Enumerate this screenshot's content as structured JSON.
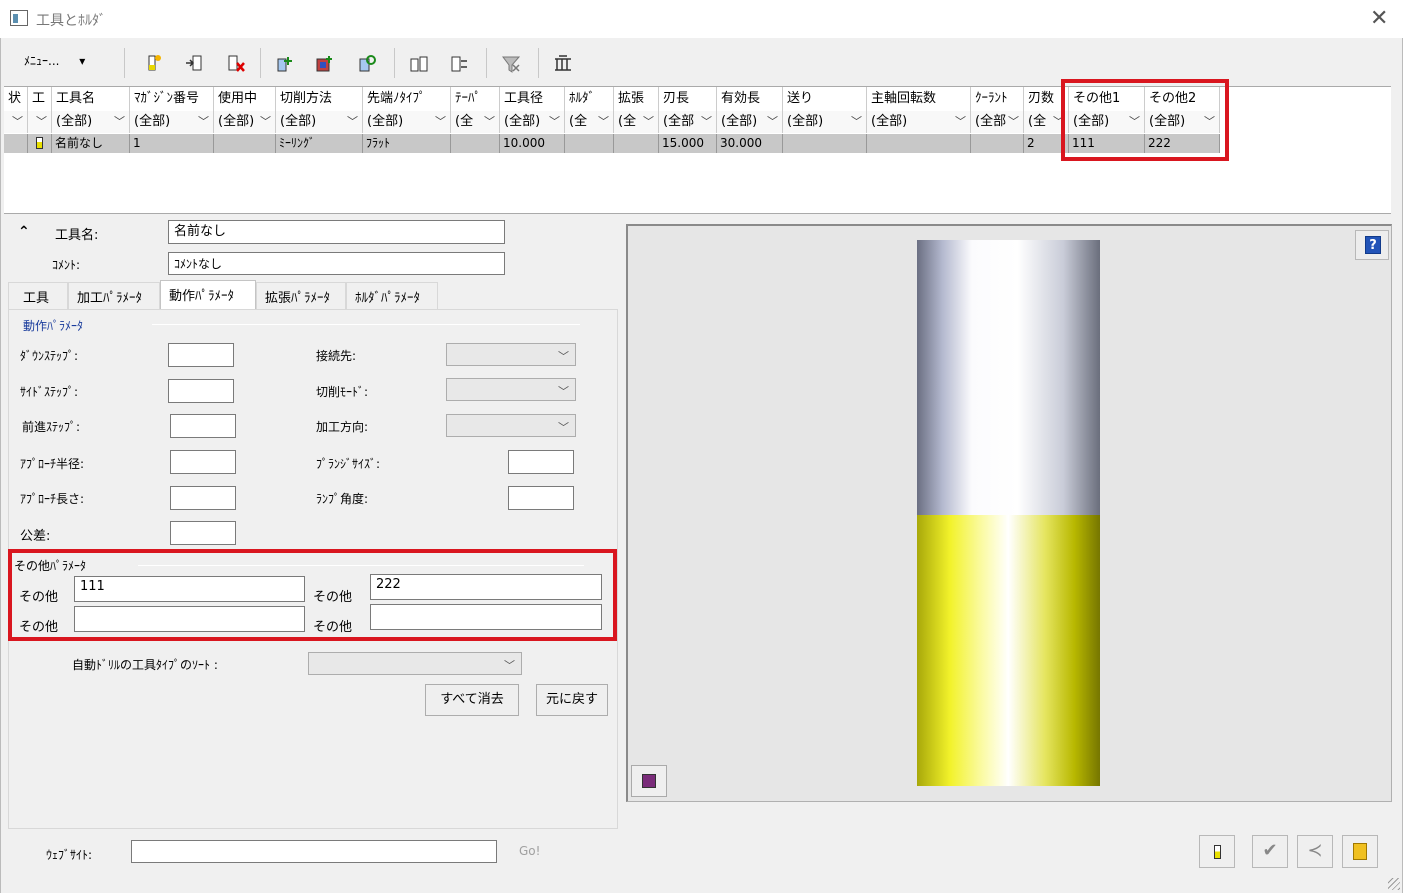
{
  "window": {
    "title": "工具とﾎﾙﾀﾞ"
  },
  "toolbar": {
    "menu_label": "ﾒﾆｭｰ...",
    "menu_arrow": "▾"
  },
  "grid": {
    "headers": [
      "状",
      "工",
      "工具名",
      "ﾏｶﾞｼﾞﾝ番号",
      "使用中",
      "切削方法",
      "先端ﾉﾀｲﾌﾟ",
      "ﾃｰﾊﾟ",
      "工具径",
      "ﾎﾙﾀﾞ",
      "拡張",
      "刃長",
      "有効長",
      "送り",
      "主軸回転数",
      "ｸｰﾗﾝﾄ",
      "刃数",
      "その他1",
      "その他2"
    ],
    "filters": [
      "",
      "",
      "(全部)",
      "(全部)",
      "(全部)",
      "(全部)",
      "(全部)",
      "(全",
      "(全部)",
      "(全",
      "(全",
      "(全部",
      "(全部)",
      "(全部)",
      "(全部)",
      "(全部",
      "(全",
      "(全部)",
      "(全部)"
    ],
    "row": [
      "",
      "",
      "名前なし",
      "1",
      "",
      "ﾐｰﾘﾝｸﾞ",
      "ﾌﾗｯﾄ",
      "",
      "10.000",
      "",
      "",
      "15.000",
      "30.000",
      "",
      "",
      "",
      "2",
      "111",
      "222"
    ]
  },
  "form": {
    "collapse_icon": "double-chevron-up-icon",
    "tool_name_label": "工具名:",
    "tool_name_value": "名前なし",
    "comment_label": "ｺﾒﾝﾄ:",
    "comment_value": "ｺﾒﾝﾄなし"
  },
  "tabs": [
    {
      "label": "工具",
      "active": false
    },
    {
      "label": "加工ﾊﾟﾗﾒｰﾀ",
      "active": false
    },
    {
      "label": "動作ﾊﾟﾗﾒｰﾀ",
      "active": true
    },
    {
      "label": "拡張ﾊﾟﾗﾒｰﾀ",
      "active": false
    },
    {
      "label": "ﾎﾙﾀﾞﾊﾟﾗﾒｰﾀ",
      "active": false
    }
  ],
  "motion": {
    "group_title": "動作ﾊﾟﾗﾒｰﾀ",
    "down_step": "ﾀﾞｳﾝｽﾃｯﾌﾟ:",
    "side_step": "ｻｲﾄﾞｽﾃｯﾌﾟ:",
    "forward_step": "前進ｽﾃｯﾌﾟ:",
    "approach_radius": "ｱﾌﾟﾛｰﾁ半径:",
    "approach_length": "ｱﾌﾟﾛｰﾁ長さ:",
    "tolerance": "公差:",
    "connect_to": "接続先:",
    "cut_mode": "切削ﾓｰﾄﾞ:",
    "cut_direction": "加工方向:",
    "plunge_size": "ﾌﾟﾗﾝｼﾞｻｲｽﾞ:",
    "ramp_angle": "ﾗﾝﾌﾟ角度:"
  },
  "other": {
    "group_title": "その他ﾊﾟﾗﾒｰﾀ",
    "label": "その他",
    "other1": "111",
    "other2": "222",
    "other3": "",
    "other4": ""
  },
  "autodrill": {
    "label": "自動ﾄﾞﾘﾙの工具ﾀｲﾌﾟのｿｰﾄ :"
  },
  "buttons": {
    "clear_all": "すべて消去",
    "restore": "元に戻す"
  },
  "website": {
    "label": "ｳｪﾌﾞｻｲﾄ:",
    "value": "",
    "go": "Go!"
  },
  "preview": {
    "help": "?"
  }
}
